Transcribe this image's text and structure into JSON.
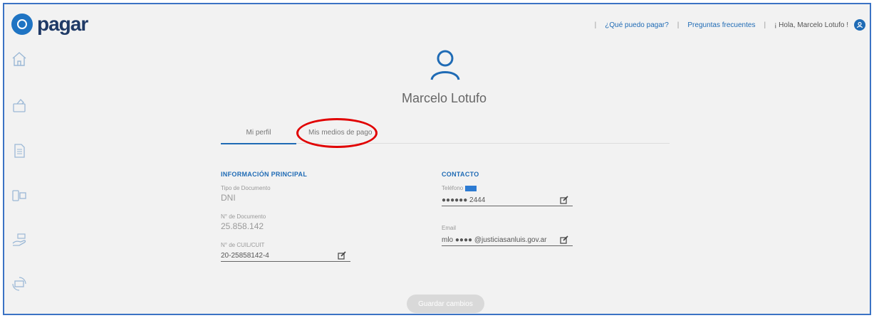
{
  "header": {
    "logo": "pagar",
    "nav": {
      "what_can_i_pay": "¿Qué puedo pagar?",
      "faq": "Preguntas frecuentes",
      "greeting": "¡ Hola, Marcelo Lotufo !"
    }
  },
  "sidebar": {
    "icons": [
      "home-icon",
      "wallet-icon",
      "document-icon",
      "payments-icon",
      "hand-money-icon",
      "refresh-money-icon"
    ]
  },
  "profile": {
    "name": "Marcelo Lotufo",
    "tabs": [
      "Mi perfil",
      "Mis medios de pago"
    ],
    "main_section": {
      "title": "INFORMACIÓN PRINCIPAL",
      "doc_type_label": "Tipo de Documento",
      "doc_type_value": "DNI",
      "doc_number_label": "N° de Documento",
      "doc_number_value": "25.858.142",
      "cuil_label": "N° de CUIL/CUIT",
      "cuil_value": "20-25858142-4"
    },
    "contact_section": {
      "title": "CONTACTO",
      "phone_label": "Teléfono",
      "phone_value": "●●●●●● 2444",
      "email_label": "Email",
      "email_value": "mlo ●●●● @justiciasanluis.gov.ar"
    },
    "save_label": "Guardar cambios"
  },
  "colors": {
    "brand": "#1f6bb5",
    "accent": "#29a8e0",
    "annotation": "#e10000"
  }
}
